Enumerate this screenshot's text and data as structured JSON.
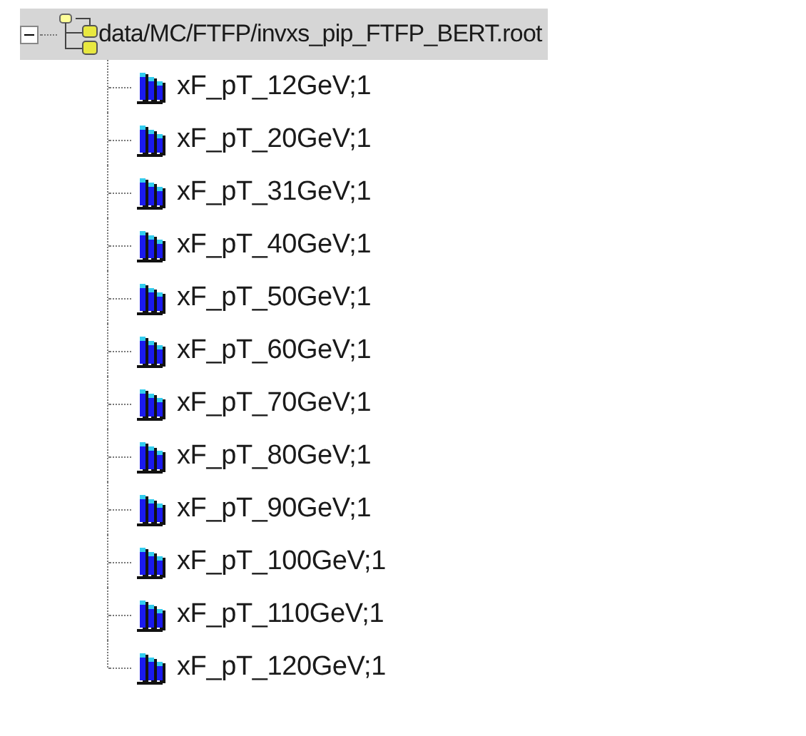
{
  "tree": {
    "label": "data/MC/FTFP/invxs_pip_FTFP_BERT.root",
    "expanded": true,
    "selected": true,
    "children": [
      {
        "label": "xF_pT_12GeV;1"
      },
      {
        "label": "xF_pT_20GeV;1"
      },
      {
        "label": "xF_pT_31GeV;1"
      },
      {
        "label": "xF_pT_40GeV;1"
      },
      {
        "label": "xF_pT_50GeV;1"
      },
      {
        "label": "xF_pT_60GeV;1"
      },
      {
        "label": "xF_pT_70GeV;1"
      },
      {
        "label": "xF_pT_80GeV;1"
      },
      {
        "label": "xF_pT_90GeV;1"
      },
      {
        "label": "xF_pT_100GeV;1"
      },
      {
        "label": "xF_pT_110GeV;1"
      },
      {
        "label": "xF_pT_120GeV;1"
      }
    ]
  }
}
